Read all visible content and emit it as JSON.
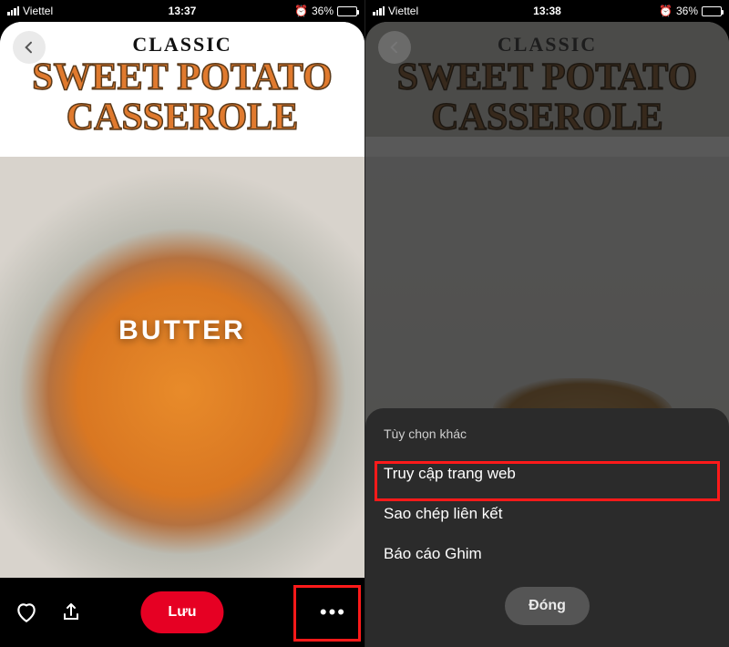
{
  "left": {
    "status": {
      "carrier": "Viettel",
      "time": "13:37",
      "battery_pct": "36%"
    },
    "title_small": "CLASSIC",
    "title_dish_line1": "SWEET POTATO",
    "title_dish_line2": "CASSEROLE",
    "overlay_word": "BUTTER",
    "save_label": "Lưu",
    "more_glyph": "•••"
  },
  "right": {
    "status": {
      "carrier": "Viettel",
      "time": "13:38",
      "battery_pct": "36%"
    },
    "title_small": "CLASSIC",
    "title_dish_line1": "SWEET POTATO",
    "title_dish_line2": "CASSEROLE",
    "sheet": {
      "title": "Tùy chọn khác",
      "items": [
        "Truy cập trang web",
        "Sao chép liên kết",
        "Báo cáo Ghim"
      ],
      "close": "Đóng"
    }
  },
  "icons": {
    "back": "chevron-left-icon",
    "heart": "heart-icon",
    "share": "share-icon",
    "more": "more-icon",
    "alarm": "alarm-icon"
  },
  "colors": {
    "accent_red": "#e60023",
    "highlight_box": "#ff1a1a",
    "sheet_bg": "#2b2b2b"
  }
}
